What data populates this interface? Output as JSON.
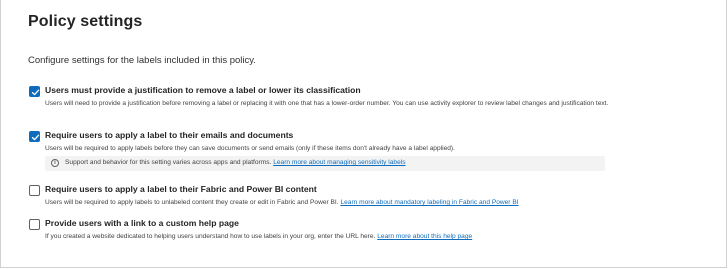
{
  "page": {
    "title": "Policy settings",
    "intro": "Configure settings for the labels included in this policy."
  },
  "options": [
    {
      "checked": true,
      "label": "Users must provide a justification to remove a label or lower its classification",
      "desc": "Users will need to provide a justification before removing a label or replacing it with one that has a lower-order number. You can use activity explorer to review label changes and justification text."
    },
    {
      "checked": true,
      "label": "Require users to apply a label to their emails and documents",
      "desc": "Users will be required to apply labels before they can save documents or send emails (only if these items don't already have a label applied).",
      "info_text": "Support and behavior for this setting varies across apps and platforms.",
      "info_link": "Learn more about managing sensitivity labels"
    },
    {
      "checked": false,
      "label": "Require users to apply a label to their Fabric and Power BI content",
      "desc": "Users will be required to apply labels to unlabeled content they create or edit in Fabric and Power BI.",
      "link": "Learn more about mandatory labeling in Fabric and Power BI"
    },
    {
      "checked": false,
      "label": "Provide users with a link to a custom help page",
      "desc": "If you created a website dedicated to helping users understand how to use labels in your org, enter the URL here.",
      "link": "Learn more about this help page"
    }
  ],
  "colors": {
    "accent": "#0f6cbd",
    "info_bg": "#f3f3f3"
  },
  "icons": {
    "checkmark": "checkmark-icon",
    "info": "info-icon"
  }
}
